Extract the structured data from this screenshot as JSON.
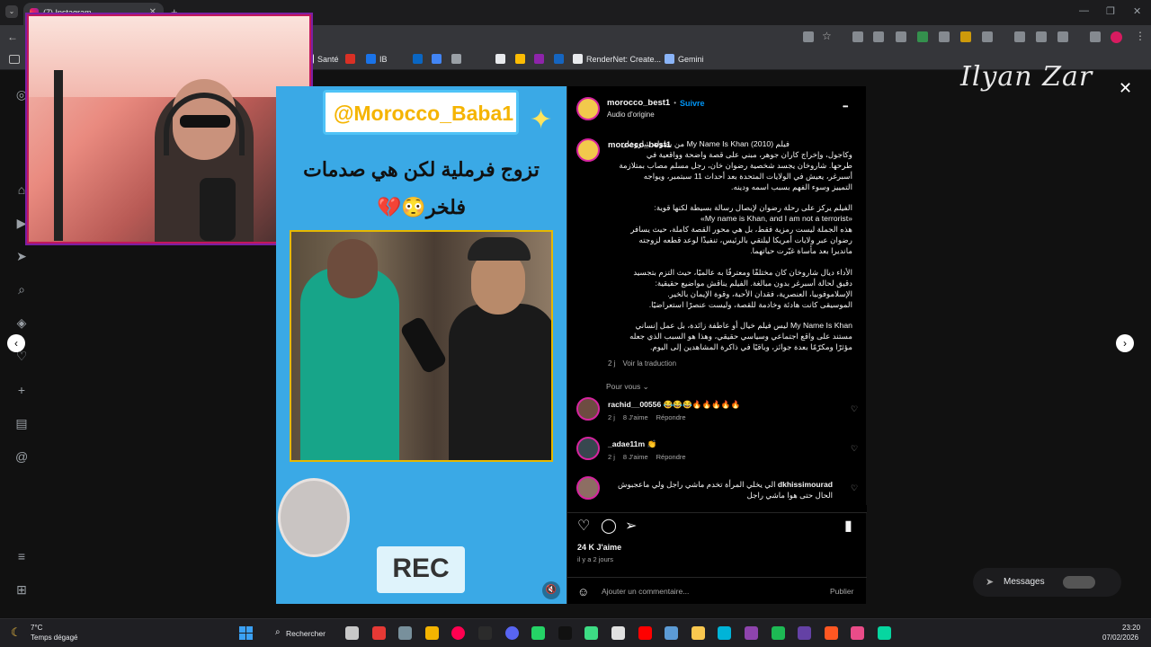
{
  "browser": {
    "tab_title": "(7) Instagram",
    "new_tab": "+",
    "bookmarks": [
      {
        "label": "Santé",
        "color": "#e8eaed"
      },
      {
        "label": "",
        "color": "#d93025"
      },
      {
        "label": "IB",
        "color": "#1a73e8"
      },
      {
        "label": "",
        "color": "#0a66c2"
      },
      {
        "label": "",
        "color": "#4285f4"
      },
      {
        "label": "",
        "color": "#9aa0a6"
      },
      {
        "label": "",
        "color": "#e8eaed"
      },
      {
        "label": "",
        "color": "#fbbc04"
      },
      {
        "label": "",
        "color": "#8e24aa"
      },
      {
        "label": "",
        "color": "#1565c0"
      },
      {
        "label": "RenderNet: Create...",
        "color": "#e8eaed"
      },
      {
        "label": "Gemini",
        "color": "#8ab4f8"
      }
    ]
  },
  "watermark": "Ilyan Zar",
  "video": {
    "handle": "@Morocco_Baba1",
    "title_line1": "تزوج فرملية لكن هي صدمات",
    "title_line2": "فلخر😳💔",
    "rec": "REC",
    "mute_icon": "🔇"
  },
  "post": {
    "username": "morocco_best1",
    "dot": "•",
    "follow": "Suivre",
    "audio": "Audio d'origine",
    "more": "•••",
    "caption_user": "morocco_best1",
    "caption_lines": [
      "فيلم My Name Is Khan (2010) من بطولة شاروخان",
      "وكاجول، وإخراج كاران جوهر، مبني على قصة واضحة وواقعية في",
      "طرحها. شاروخان يجسد شخصية رضوان خان، رجل مسلم مصاب بمتلازمة",
      "أسبرغر، يعيش في الولايات المتحدة بعد أحداث 11 سبتمبر، ويواجه",
      "التمييز وسوء الفهم بسبب اسمه ودينه.",
      "",
      "الفيلم يركز على رحلة رضوان لإيصال رسالة بسيطة لكنها قوية:",
      "«My name is Khan, and I am not a terrorist»",
      "هذه الجملة ليست رمزية فقط، بل هي محور القصة كاملة، حيث يسافر",
      "رضوان عبر ولايات أمريكا ليلتقي بالرئيس، تنفيذًا لوعد قطعه لزوجته",
      "مانديرا بعد مأساة غيّرت حياتهما.",
      "",
      "الأداء ديال شاروخان كان مختلفًا ومعترفًا به عالميًا، حيث التزم بتجسيد",
      "دقيق لحالة أسبرغر بدون مبالغة. الفيلم يناقش مواضيع حقيقية:",
      "الإسلاموفوبيا، العنصرية، فقدان الأحبة، وقوة الإيمان بالخير.",
      "الموسيقى كانت هادئة وخادمة للقصة، وليست عنصرًا استعراضيًا.",
      "",
      "My Name Is Khan ليس فيلم خيال أو عاطفة زائدة، بل عمل إنساني",
      "مستند على واقع اجتماعي وسياسي حقيقي، وهذا هو السبب الذي جعله",
      "مؤثرًا ومكرّمًا بعدة جوائز، وباقيًا في ذاكرة المشاهدين إلى اليوم."
    ],
    "caption_age": "2 j",
    "see_translation": "Voir la traduction",
    "for_you": "Pour vous",
    "for_you_chevron": "⌄",
    "comments": [
      {
        "user": "rachid__00556",
        "text": "😂😂😂🔥🔥🔥🔥🔥",
        "age": "2 j",
        "likes": "8 J'aime",
        "reply": "Répondre",
        "avatar": "#6d4c41"
      },
      {
        "user": "_adae11m",
        "text": "👏",
        "age": "2 j",
        "likes": "8 J'aime",
        "reply": "Répondre",
        "avatar": "#37474f"
      },
      {
        "user": "dkhissimourad",
        "text": "الي يخلي المرأة تخدم ماشي راجل ولي ماعجبوش الحال حتى هوا ماشي راجل",
        "age": "1 j",
        "likes": "700 J'aime",
        "reply": "Répondre",
        "avatar": "#8d6e63",
        "see_translation": "Voir la traduction"
      }
    ],
    "likes": "24 K J'aime",
    "date": "il y a 2 jours",
    "add_comment_placeholder": "Ajouter un commentaire...",
    "publish": "Publier"
  },
  "overlay": {
    "close": "✕",
    "prev": "‹",
    "next": "›",
    "messages": "Messages"
  },
  "taskbar": {
    "weather_temp": "7°C",
    "weather_desc": "Temps dégagé",
    "search": "Rechercher",
    "time": "23:20",
    "date": "07/02/2026",
    "start_color": "#3ba1f5",
    "app_colors": [
      "#c8c8c8",
      "#e53935",
      "#78909c",
      "#f4b400",
      "#ff0050",
      "#2b2b2b",
      "#5865f2",
      "#25d366",
      "#111111",
      "#3ddc84",
      "#e0e0e0",
      "#ff0000",
      "#5c9bd5",
      "#f9c74f",
      "#00b4d8",
      "#8e44ad",
      "#1db954",
      "#6441a5",
      "#ff5722",
      "#ea4c89",
      "#06d6a0"
    ]
  }
}
